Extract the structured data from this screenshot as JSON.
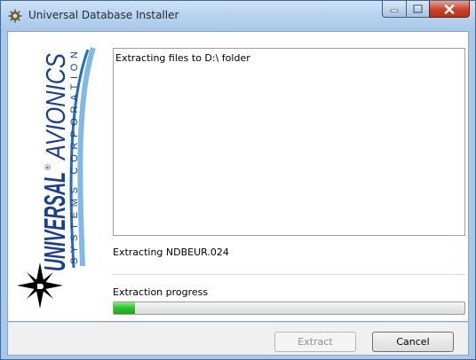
{
  "window": {
    "title": "Universal Database Installer"
  },
  "logo": {
    "brand_main": "UNIVERSAL",
    "brand_second": "AVIONICS",
    "registered": "®",
    "tagline": "SYSTEMS CORPORATION",
    "colors": {
      "navy": "#1a3f8f",
      "blue": "#2c8fd6",
      "black": "#000000"
    }
  },
  "log": {
    "lines": [
      "Extracting files to D:\\ folder"
    ]
  },
  "status": {
    "current_file": "Extracting NDBEUR.024"
  },
  "progress": {
    "label": "Extraction progress",
    "fraction": 0.06,
    "color": "#2ec52e"
  },
  "buttons": {
    "extract": {
      "label": "Extract",
      "enabled": false
    },
    "cancel": {
      "label": "Cancel",
      "enabled": true
    }
  }
}
